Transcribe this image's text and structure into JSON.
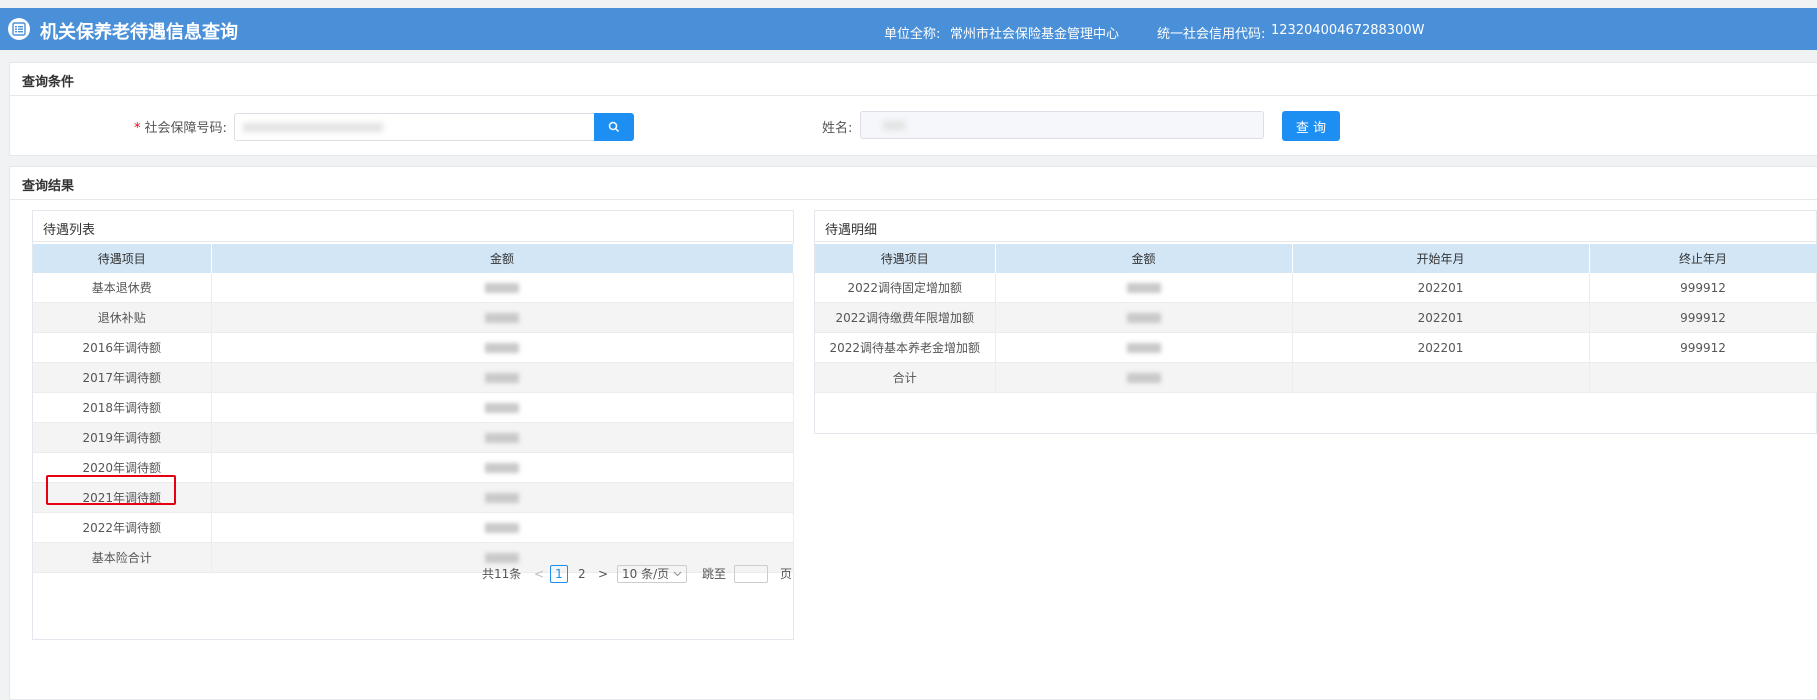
{
  "header": {
    "title": "机关保养老待遇信息查询",
    "org_label": "单位全称:",
    "org_name": "常州市社会保险基金管理中心",
    "code_label": "统一社会信用代码:",
    "code_value": "12320400467288300W"
  },
  "query": {
    "panel_title": "查询条件",
    "ssn_required_mark": "*",
    "ssn_label": "社会保障号码:",
    "name_label": "姓名:",
    "query_button": "查 询"
  },
  "results": {
    "panel_title": "查询结果",
    "list": {
      "title": "待遇列表",
      "columns": [
        "待遇项目",
        "金额"
      ],
      "rows": [
        "基本退休费",
        "退休补贴",
        "2016年调待额",
        "2017年调待额",
        "2018年调待额",
        "2019年调待额",
        "2020年调待额",
        "2021年调待额",
        "2022年调待额",
        "基本险合计"
      ]
    },
    "detail": {
      "title": "待遇明细",
      "columns": [
        "待遇项目",
        "金额",
        "开始年月",
        "终止年月"
      ],
      "rows": [
        {
          "item": "2022调待固定增加额",
          "start": "202201",
          "end": "999912"
        },
        {
          "item": "2022调待缴费年限增加额",
          "start": "202201",
          "end": "999912"
        },
        {
          "item": "2022调待基本养老金增加额",
          "start": "202201",
          "end": "999912"
        },
        {
          "item": "合计",
          "start": "",
          "end": ""
        }
      ]
    }
  },
  "pagination": {
    "total": "共11条",
    "prev": "<",
    "current": "1",
    "page2": "2",
    "next": ">",
    "page_size": "10 条/页",
    "jump_label": "跳至",
    "page_unit": "页"
  },
  "colors": {
    "header_bg": "#4a90d9",
    "primary": "#1d8ff2",
    "table_header": "#d3e6f6",
    "highlight": "#e60012"
  },
  "icons": [
    "list-icon",
    "search-icon",
    "chevron-down-icon"
  ]
}
